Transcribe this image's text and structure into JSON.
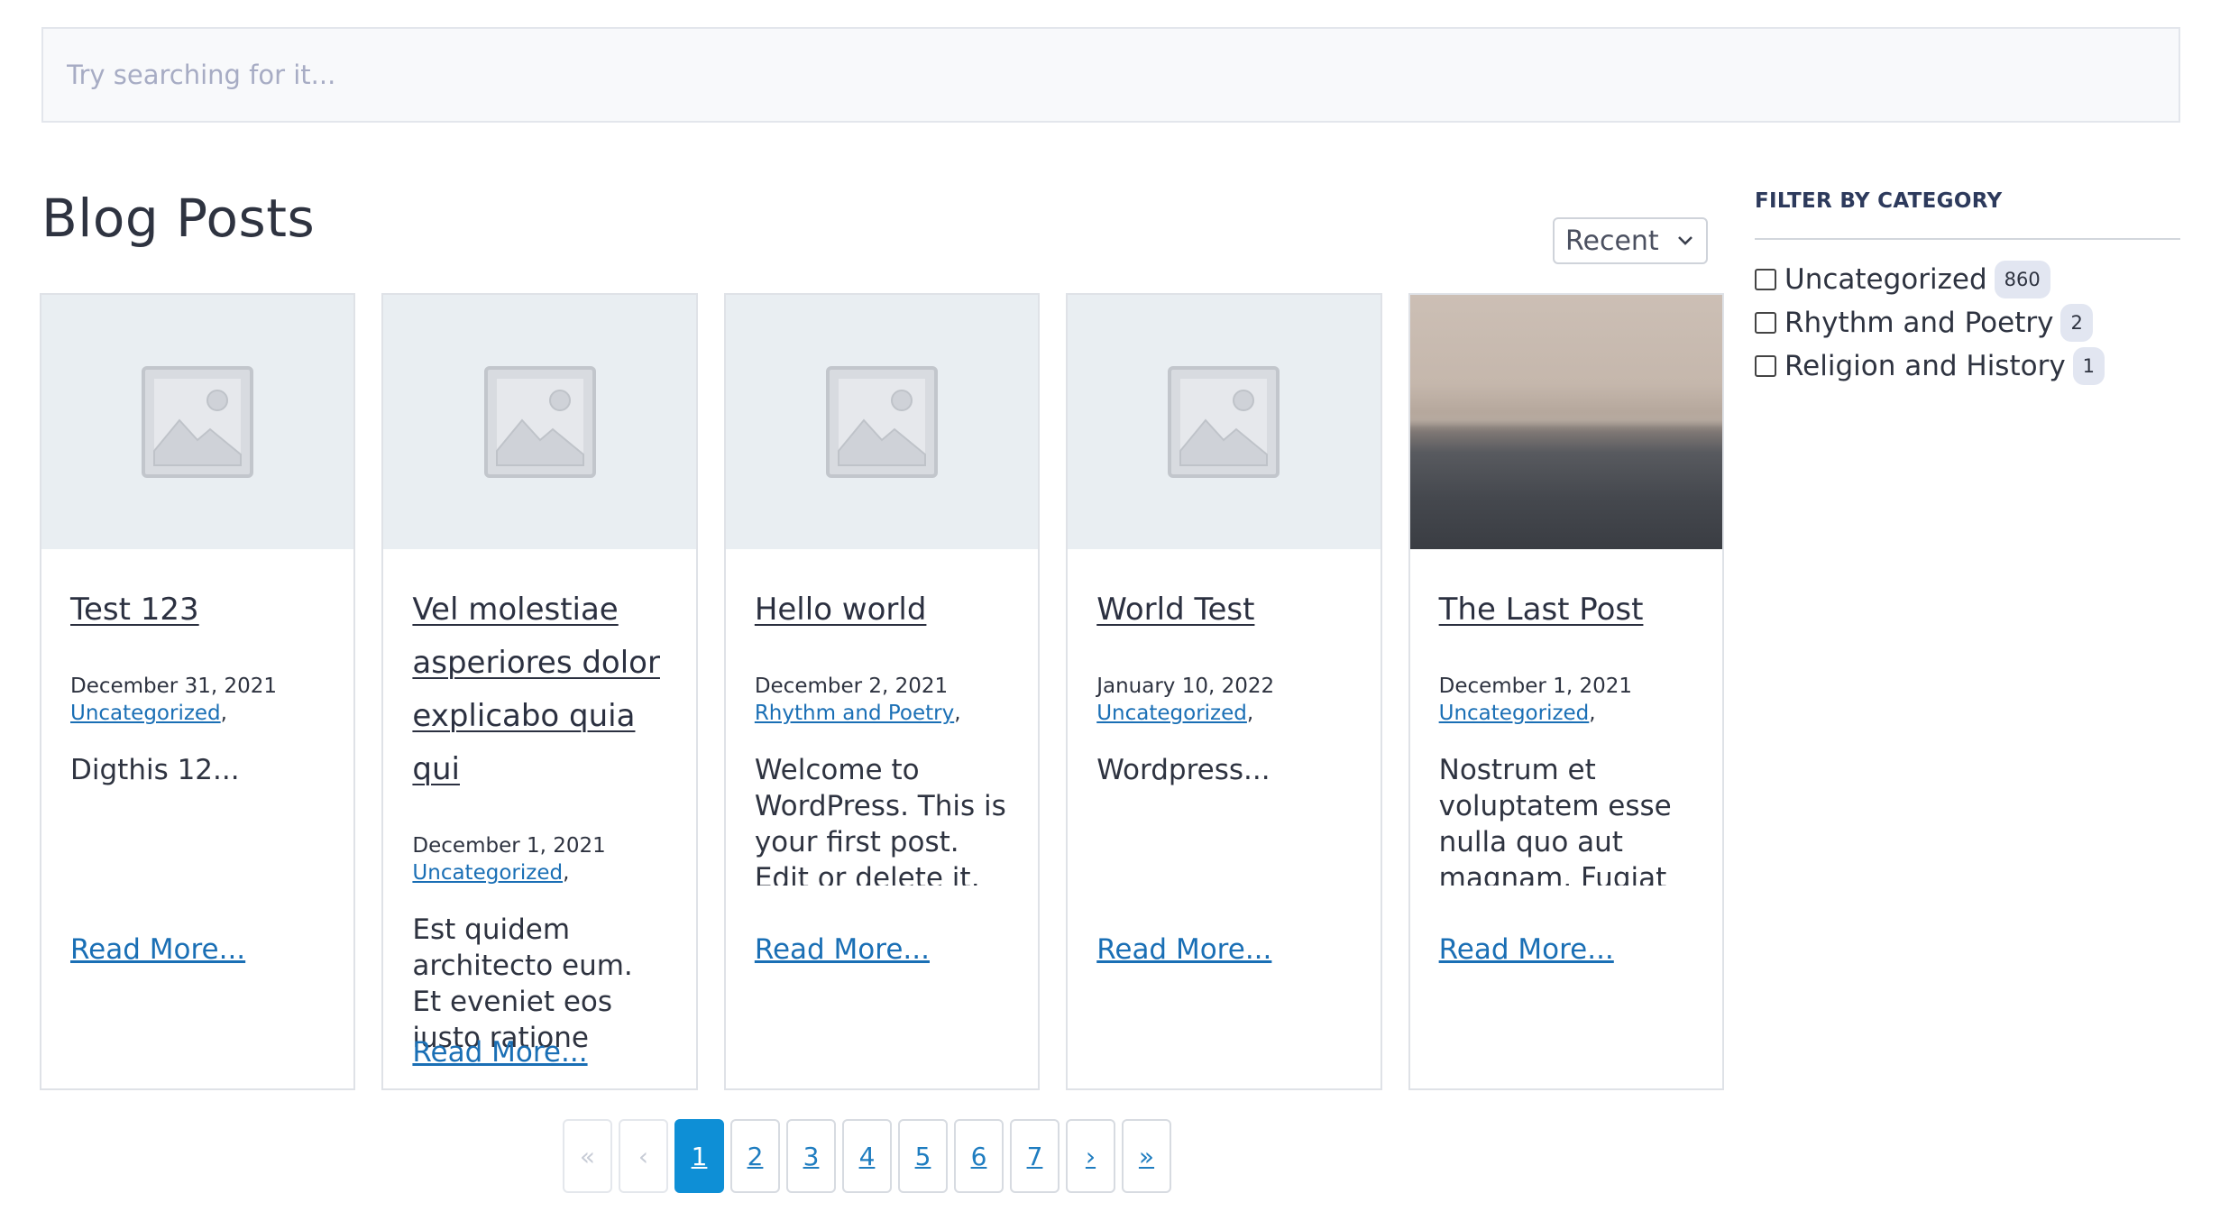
{
  "search": {
    "placeholder": "Try searching for it..."
  },
  "page_title": "Blog Posts",
  "sort": {
    "selected": "Recent"
  },
  "posts": [
    {
      "title": "Test 123",
      "date": "December 31, 2021",
      "category": "Uncategorized",
      "excerpt": "Digthis 12...",
      "read_more": "Read More...",
      "image": "placeholder"
    },
    {
      "title": "Vel molestiae asperiores dolor explicabo quia qui",
      "date": "December 1, 2021",
      "category": "Uncategorized",
      "excerpt": "Est quidem architecto eum. Et eveniet eos iusto ratione earum. Fugiat",
      "read_more": "Read More...",
      "image": "placeholder"
    },
    {
      "title": "Hello world",
      "date": "December 2, 2021",
      "category": "Rhythm and Poetry",
      "excerpt": "Welcome to WordPress. This is your first post. Edit or delete it, then start",
      "read_more": "Read More...",
      "image": "placeholder"
    },
    {
      "title": "World Test",
      "date": "January 10, 2022",
      "category": "Uncategorized",
      "excerpt": "Wordpress...",
      "read_more": "Read More...",
      "image": "placeholder"
    },
    {
      "title": "The Last Post",
      "date": "December 1, 2021",
      "category": "Uncategorized",
      "excerpt": "Nostrum et voluptatem esse nulla quo aut magnam. Fugiat",
      "read_more": "Read More...",
      "image": "photo-sea"
    }
  ],
  "pagination": {
    "first": "«",
    "prev": "‹",
    "pages": [
      "1",
      "2",
      "3",
      "4",
      "5",
      "6",
      "7"
    ],
    "current": "1",
    "next": "›",
    "last": "»"
  },
  "filter": {
    "title": "FILTER BY CATEGORY",
    "categories": [
      {
        "label": "Uncategorized",
        "count": "860"
      },
      {
        "label": "Rhythm and Poetry",
        "count": "2"
      },
      {
        "label": "Religion and History",
        "count": "1"
      }
    ]
  },
  "colors": {
    "link": "#1a6fb5",
    "active_page": "#0e8fd6",
    "badge": "#e2e6f1"
  },
  "icons": {
    "thumb": "image-placeholder-icon",
    "sort": "chevron-down-icon"
  }
}
